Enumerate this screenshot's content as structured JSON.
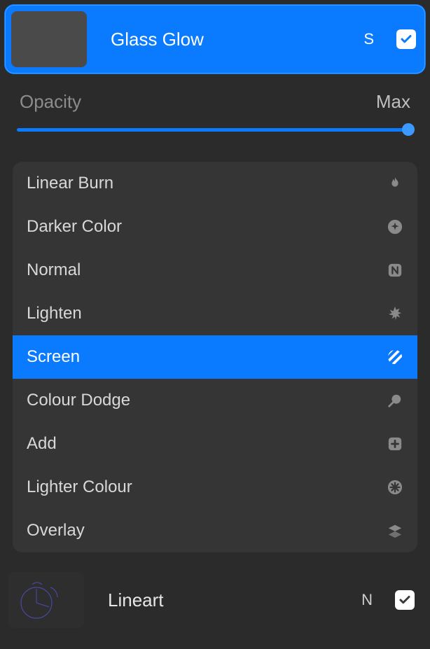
{
  "selected_layer": {
    "name": "Glass Glow",
    "mode_letter": "S",
    "visible": true
  },
  "opacity": {
    "label": "Opacity",
    "value_text": "Max",
    "percent": 100
  },
  "blend_modes": [
    {
      "label": "Linear Burn",
      "icon": "flame",
      "selected": false
    },
    {
      "label": "Darker Color",
      "icon": "sparkle-plus",
      "selected": false
    },
    {
      "label": "Normal",
      "icon": "n-badge",
      "selected": false
    },
    {
      "label": "Lighten",
      "icon": "burst",
      "selected": false
    },
    {
      "label": "Screen",
      "icon": "stripes",
      "selected": true
    },
    {
      "label": "Colour Dodge",
      "icon": "lollipop",
      "selected": false
    },
    {
      "label": "Add",
      "icon": "plus-badge",
      "selected": false
    },
    {
      "label": "Lighter Colour",
      "icon": "asterisk",
      "selected": false
    },
    {
      "label": "Overlay",
      "icon": "layers",
      "selected": false
    }
  ],
  "next_layer": {
    "name": "Lineart",
    "mode_letter": "N",
    "visible": true
  }
}
